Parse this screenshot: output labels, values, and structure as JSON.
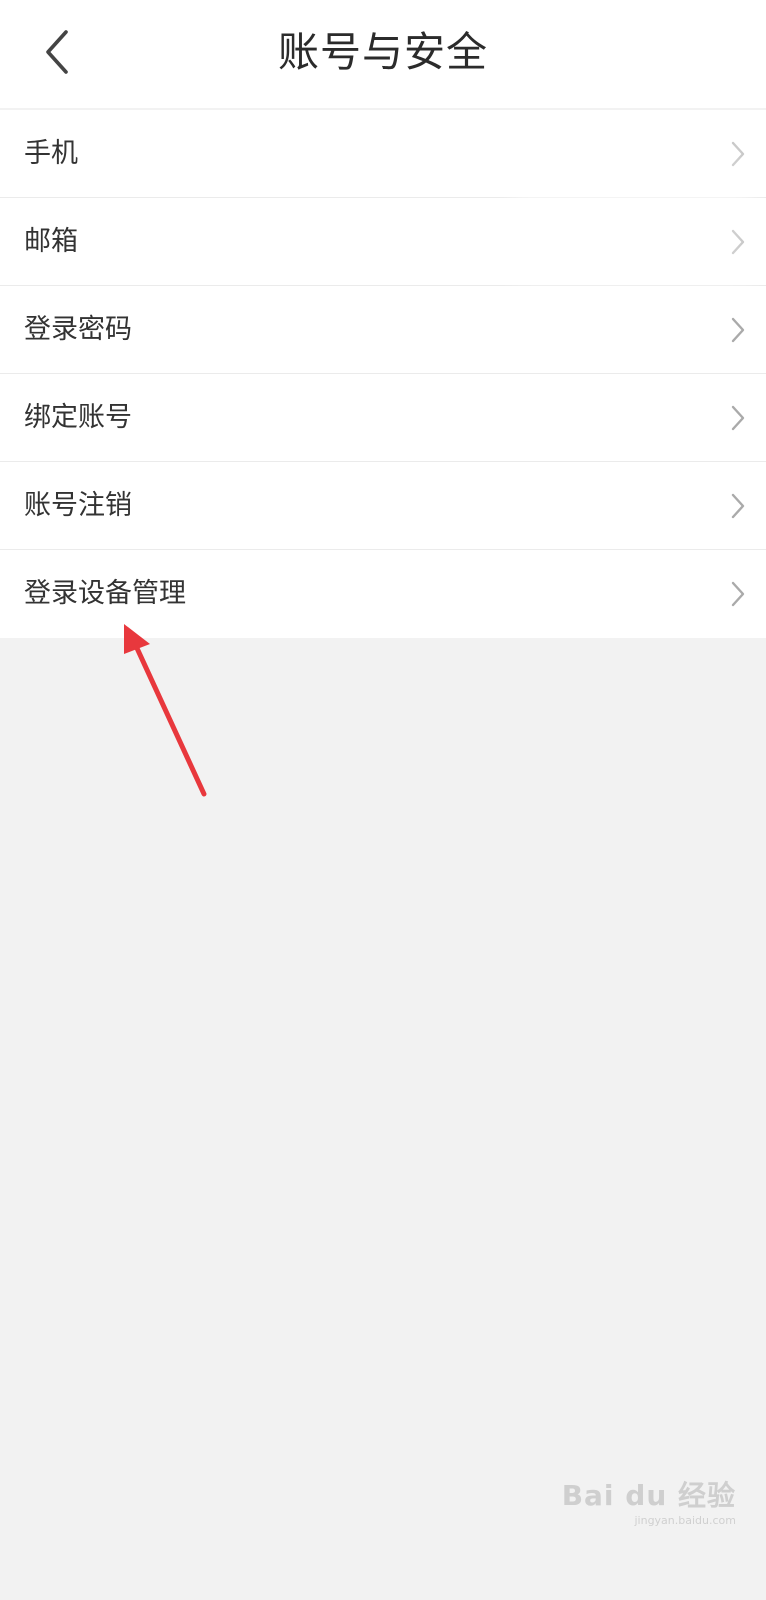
{
  "header": {
    "title": "账号与安全",
    "back_icon": "chevron-left-icon"
  },
  "list": {
    "items": [
      {
        "label": "手机",
        "value": "",
        "chevron": "chevron-right-icon"
      },
      {
        "label": "邮箱",
        "value": "",
        "chevron": "chevron-right-icon"
      },
      {
        "label": "登录密码",
        "value": "",
        "chevron": "chevron-right-icon"
      },
      {
        "label": "绑定账号",
        "value": "",
        "chevron": "chevron-right-icon"
      },
      {
        "label": "账号注销",
        "value": "",
        "chevron": "chevron-right-icon"
      },
      {
        "label": "登录设备管理",
        "value": "",
        "chevron": "chevron-right-icon"
      }
    ]
  },
  "annotation": {
    "arrow_color": "#e8383d",
    "points_to": "登录设备管理"
  },
  "watermark": {
    "logo": "Bai du 经验",
    "url": "jingyan.baidu.com"
  },
  "colors": {
    "background": "#f2f2f2",
    "surface": "#ffffff",
    "text": "#333333",
    "chevron": "#aaaaaa",
    "divider": "#ebebeb"
  }
}
